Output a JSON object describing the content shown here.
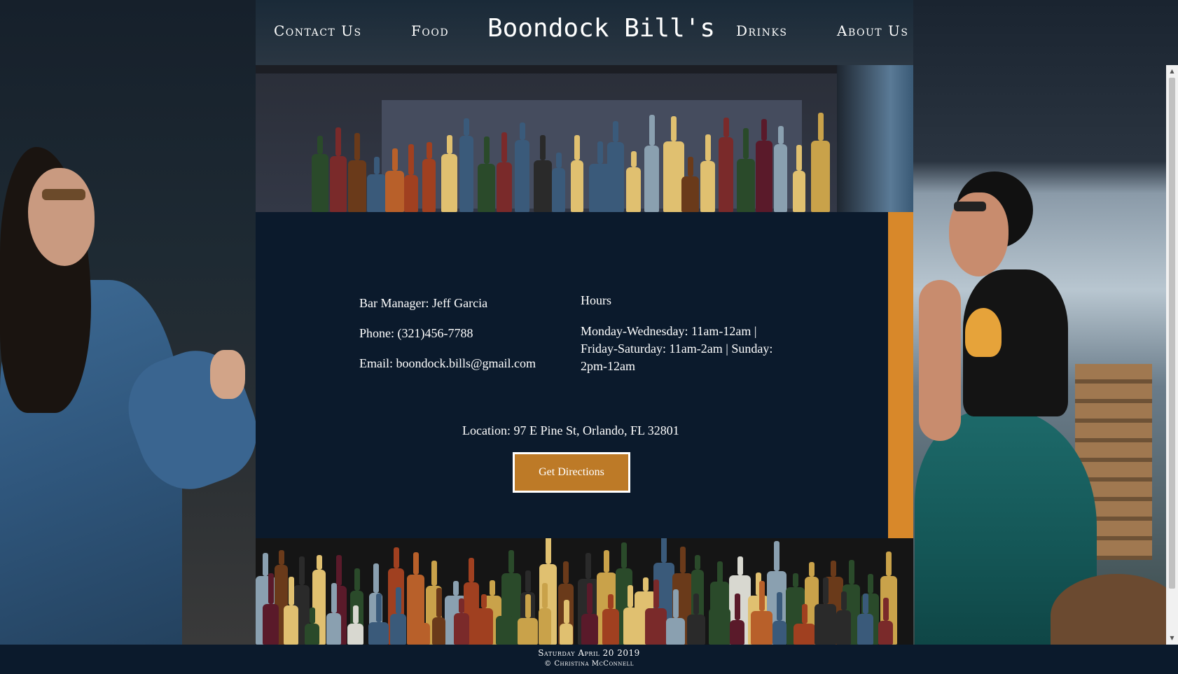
{
  "nav": {
    "contact": "Contact Us",
    "food": "Food",
    "brand": "Boondock Bill's",
    "drinks": "Drinks",
    "about": "About Us"
  },
  "contact": {
    "manager": "Bar Manager: Jeff Garcia",
    "phone": "Phone: (321)456-7788",
    "email": "Email: boondock.bills@gmail.com",
    "hours_title": "Hours",
    "hours_line1": "Monday-Wednesday: 11am-12am |",
    "hours_line2": "Friday-Saturday: 11am-2am | Sunday:",
    "hours_line3": "2pm-12am",
    "location": "Location: 97 E Pine St, Orlando, FL 32801",
    "directions_button": "Get Directions"
  },
  "footer": {
    "date": "Saturday April 20 2019",
    "credit": "© Christina McConnell"
  },
  "colors": {
    "card_bg": "#0b1a2c",
    "accent_orange": "#d8882a",
    "button_bg": "#bd7a27",
    "footer_bg": "#0b1a2c"
  },
  "icons": {
    "scroll_up": "scroll-up-arrow-icon",
    "scroll_down": "scroll-down-arrow-icon"
  }
}
